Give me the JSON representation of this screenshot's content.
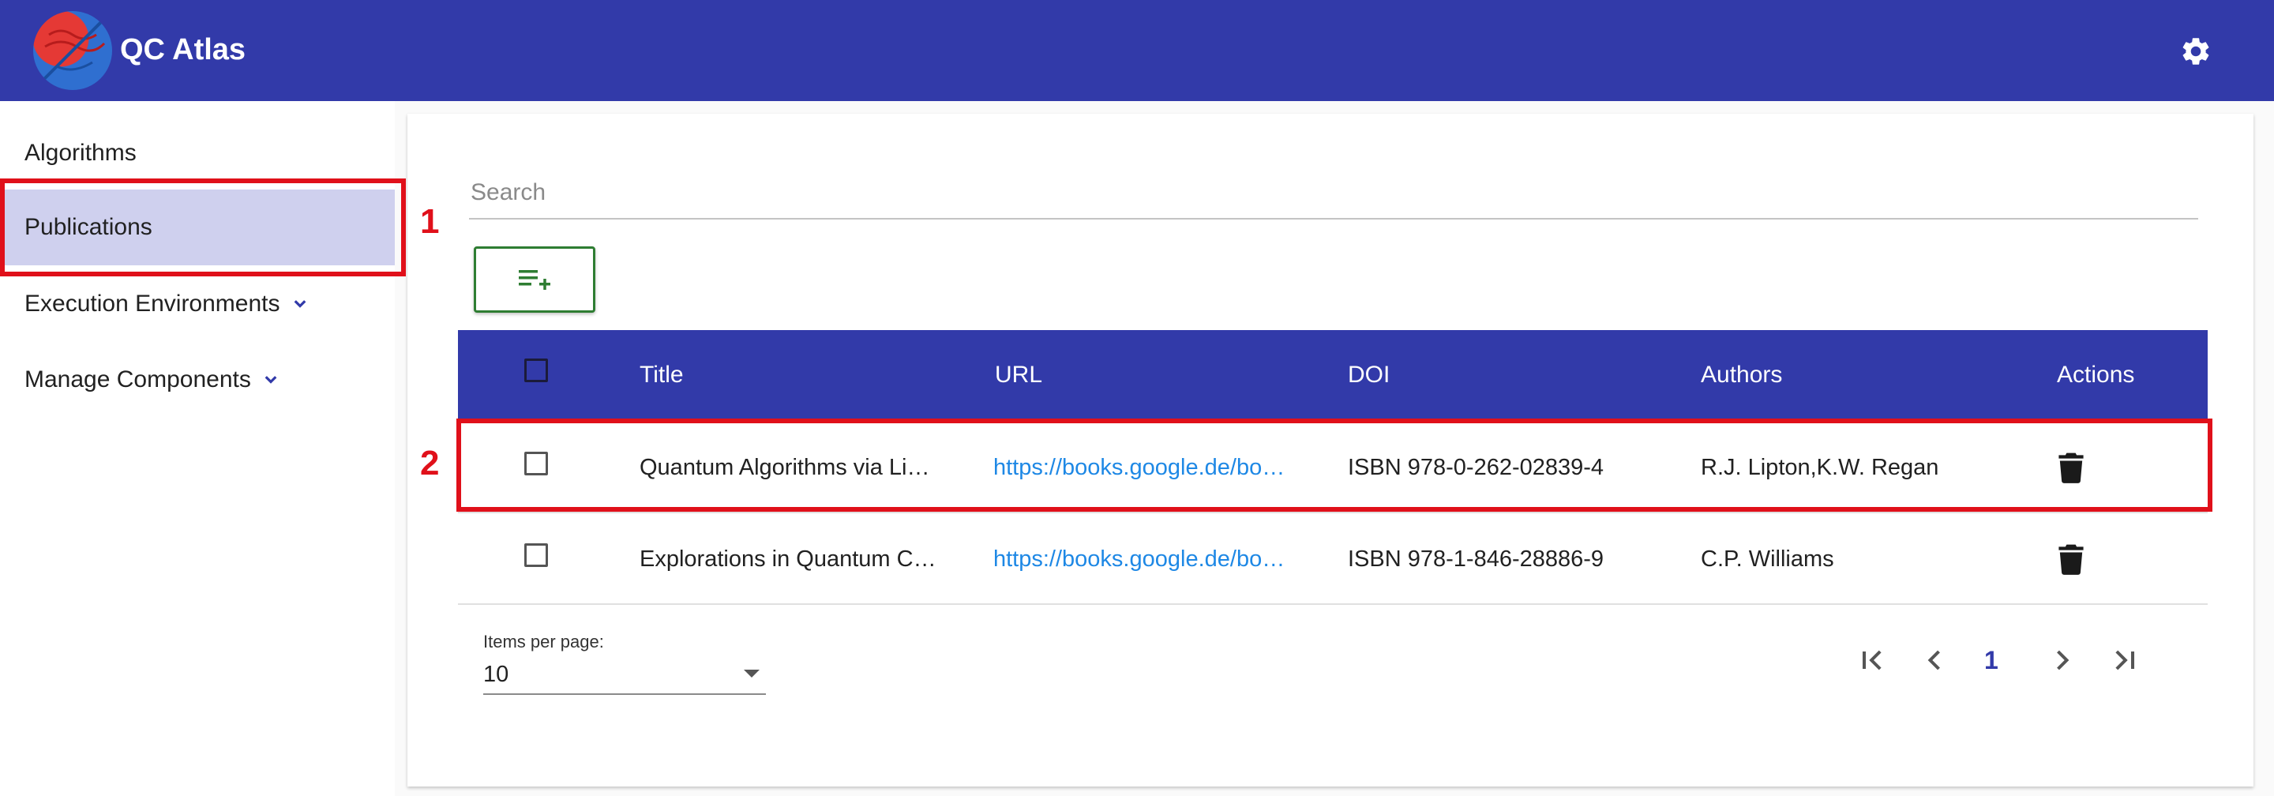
{
  "header": {
    "title": "QC Atlas",
    "logo_icon": "qc-atlas-logo",
    "settings_icon": "gear-icon"
  },
  "sidebar": {
    "items": [
      {
        "label": "Algorithms"
      },
      {
        "label": "Publications",
        "active": true
      },
      {
        "label": "Execution Environments",
        "icon": "chevron-down-icon"
      },
      {
        "label": "Manage Components",
        "icon": "chevron-down-icon"
      }
    ]
  },
  "annotations": {
    "one": "1",
    "two": "2"
  },
  "search": {
    "placeholder": "Search"
  },
  "toolbar": {
    "add_icon": "playlist-add-icon"
  },
  "table": {
    "columns": [
      "Title",
      "URL",
      "DOI",
      "Authors",
      "Actions"
    ],
    "rows": [
      {
        "title": "Quantum Algorithms via Linear Algebra",
        "url": "https://books.google.de/books?id=",
        "doi": "ISBN 978-0-262-02839-4",
        "authors": "R.J. Lipton,K.W. Regan"
      },
      {
        "title": "Explorations in Quantum Computing",
        "url": "https://books.google.de/books?id=",
        "doi": "ISBN 978-1-846-28886-9",
        "authors": "C.P. Williams"
      }
    ]
  },
  "paginator": {
    "items_per_page_label": "Items per page:",
    "items_per_page": "10",
    "current_page": "1"
  },
  "colors": {
    "primary": "#323aa9",
    "active_bg": "#cfd0ee",
    "link": "#1e88e5",
    "annotation": "#e0101a"
  }
}
